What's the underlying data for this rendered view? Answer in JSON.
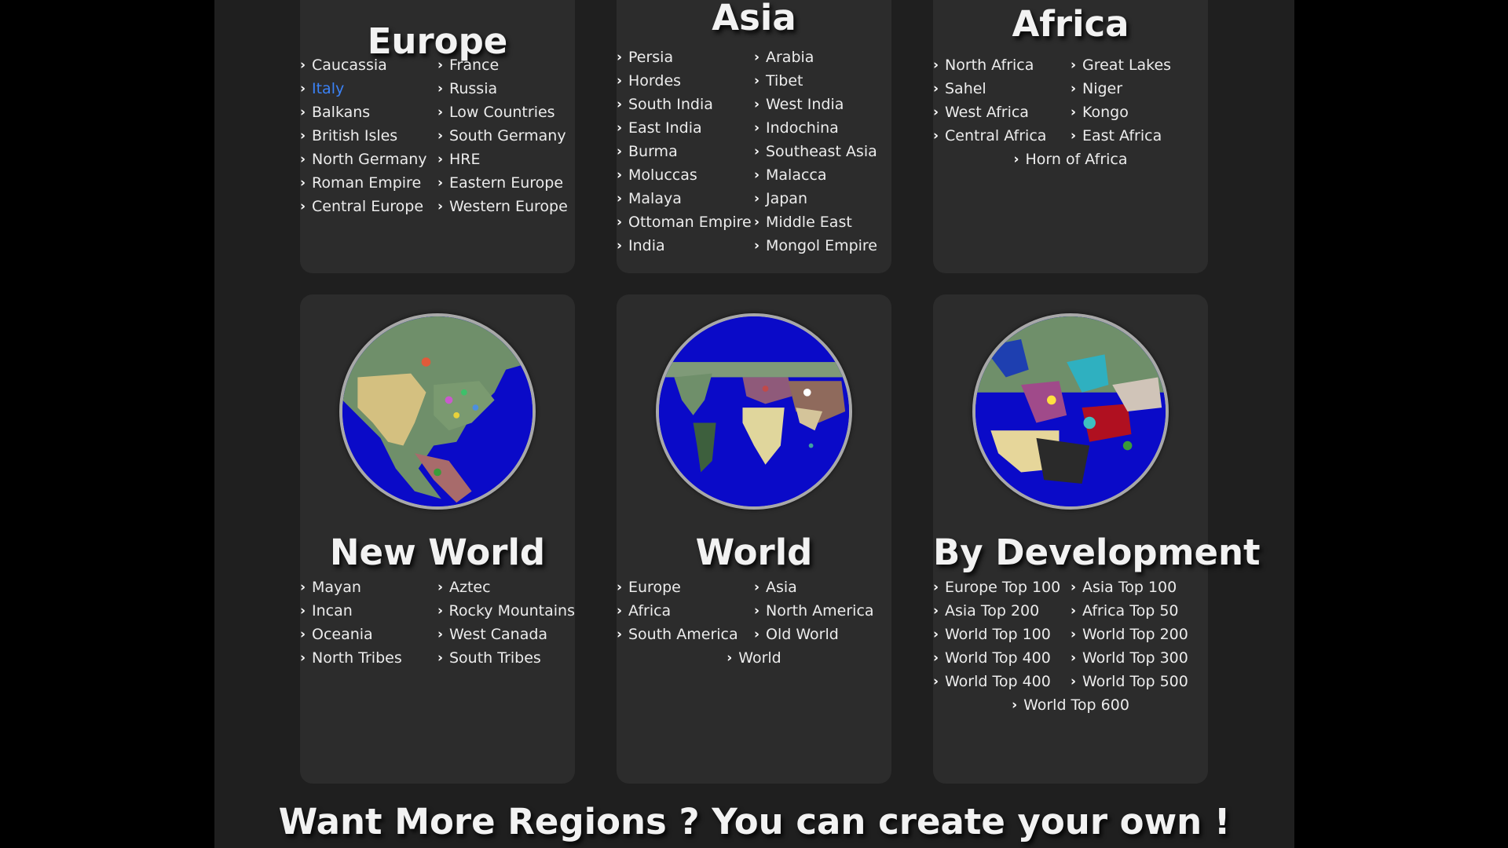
{
  "cards": {
    "europe": {
      "title": "Europe",
      "items": [
        "Caucassia",
        "France",
        "Italy",
        "Russia",
        "Balkans",
        "Low Countries",
        "British Isles",
        "South Germany",
        "North Germany",
        "HRE",
        "Roman Empire",
        "Eastern Europe",
        "Central Europe",
        "Western Europe"
      ],
      "active": "Italy"
    },
    "asia": {
      "title": "Asia",
      "items": [
        "Persia",
        "Arabia",
        "Hordes",
        "Tibet",
        "South India",
        "West India",
        "East India",
        "Indochina",
        "Burma",
        "Southeast Asia",
        "Moluccas",
        "Malacca",
        "Malaya",
        "Japan",
        "Ottoman Empire",
        "Middle East",
        "India",
        "Mongol Empire"
      ]
    },
    "africa": {
      "title": "Africa",
      "items": [
        "North Africa",
        "Great Lakes",
        "Sahel",
        "Niger",
        "West Africa",
        "Kongo",
        "Central Africa",
        "East Africa",
        "Horn of Africa"
      ]
    },
    "new_world": {
      "title": "New World",
      "items": [
        "Mayan",
        "Aztec",
        "Incan",
        "Rocky Mountains",
        "Oceania",
        "West Canada",
        "North Tribes",
        "South Tribes"
      ]
    },
    "world": {
      "title": "World",
      "items": [
        "Europe",
        "Asia",
        "Africa",
        "North America",
        "South America",
        "Old World",
        "World"
      ]
    },
    "development": {
      "title": "By Development",
      "items": [
        "Europe Top 100",
        "Asia Top 100",
        "Asia Top 200",
        "Africa Top 50",
        "World Top 100",
        "World Top 200",
        "World Top 400",
        "World Top 300",
        "World Top 400",
        "World Top 500",
        "World Top 600"
      ]
    }
  },
  "footer": {
    "title": "Want More Regions ? You can create your own !"
  },
  "colors": {
    "accent": "#3b82f6",
    "ocean": "#0a0ac8",
    "card": "#2c2c2c",
    "background": "#1f1f1f"
  },
  "icons": {
    "item_marker": "chevron-right-icon"
  }
}
